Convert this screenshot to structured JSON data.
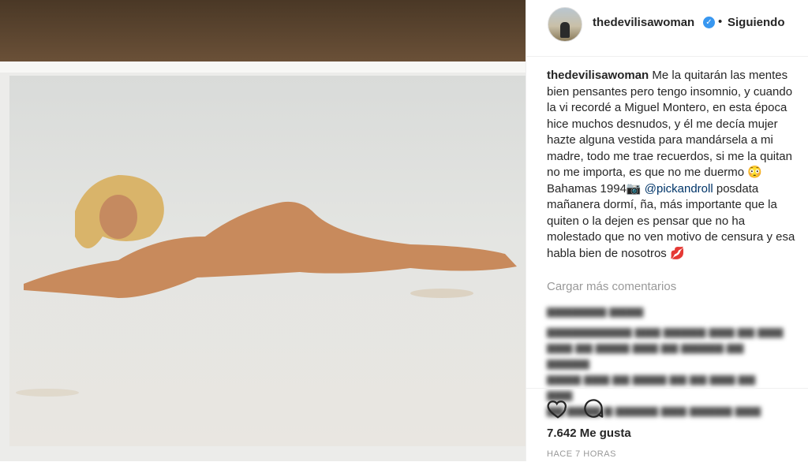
{
  "post": {
    "username": "thedevilisawoman",
    "separator": "•",
    "follow_label": "Siguiendo",
    "caption_user": "thedevilisawoman",
    "caption_text_1": "Me la quitarán las mentes bien pensantes pero tengo insomnio, y cuando la vi recordé a Miguel Montero, en esta época hice muchos desnudos, y él me decía mujer hazte alguna vestida para mandársela a mi madre, todo me trae recuerdos, si me la quitan no me importa, es que no me duermo 😳 Bahamas 1994📷 ",
    "caption_mention": "@pickandroll",
    "caption_text_2": " posdata mañanera dormí, ña, más importante que la quiten o la dejen es pensar que no ha molestado que no ven motivo de censura y esa habla bien de nosotros 💋",
    "load_more": "Cargar más comentarios",
    "likes": "7.642 Me gusta",
    "time_ago": "HACE 7 HORAS"
  },
  "icons": {
    "verified": "verified-badge-icon",
    "like": "heart-icon",
    "comment": "comment-bubble-icon"
  },
  "colors": {
    "verified_blue": "#3897f0",
    "mention_blue": "#003569",
    "muted_gray": "#999999",
    "text_dark": "#262626"
  }
}
